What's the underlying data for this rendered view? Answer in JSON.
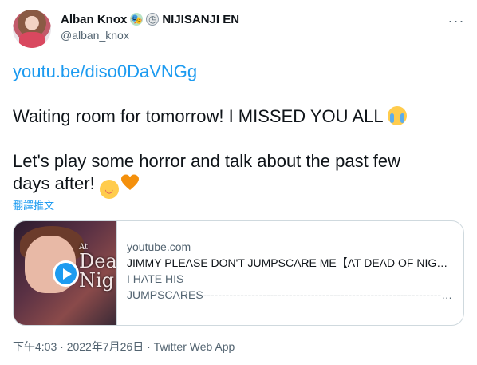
{
  "user": {
    "display_name": "Alban Knox",
    "affiliation": "NIJISANJI EN",
    "handle": "@alban_knox",
    "badge_icons": [
      "performing-arts-icon",
      "clock-icon"
    ]
  },
  "tweet": {
    "link": "youtu.be/diso0DaVNGg",
    "line1": "Waiting room for tomorrow! I MISSED YOU ALL",
    "line2a": "Let's play some horror and talk about the past few",
    "line2b": "days after!",
    "translate": "翻譯推文"
  },
  "card": {
    "domain": "youtube.com",
    "title": "JIMMY PLEASE DON'T JUMPSCARE ME【AT DEAD OF NIGHT】",
    "desc_line1": "I HATE HIS",
    "desc_line2": "JUMPSCARES-------------------------------------------------------------------------",
    "thumb_small": "At",
    "thumb_big1": "Dea",
    "thumb_big2": "Nig"
  },
  "meta": {
    "text": "下午4:03 · 2022年7月26日 · Twitter Web App"
  },
  "colors": {
    "accent": "#1d9bf0",
    "text": "#0f1419",
    "secondary": "#536471",
    "heart": "#f4900c"
  }
}
